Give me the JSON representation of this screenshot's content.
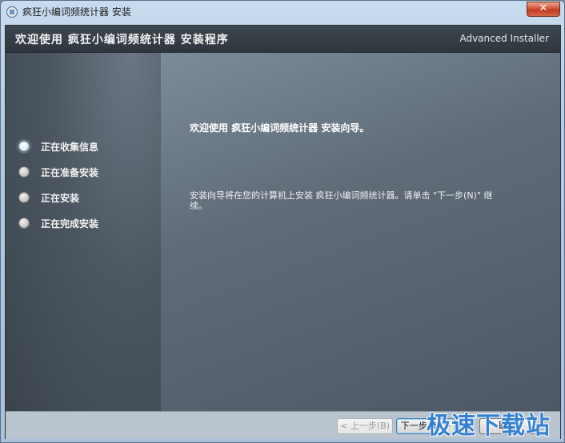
{
  "window": {
    "title": "疯狂小编词频统计器 安装",
    "close_glyph": "✕"
  },
  "header": {
    "title": "欢迎使用 疯狂小编词频统计器 安装程序",
    "brand": "Advanced Installer"
  },
  "steps": [
    {
      "label": "正在收集信息",
      "active": true
    },
    {
      "label": "正在准备安装",
      "active": false
    },
    {
      "label": "正在安装",
      "active": false
    },
    {
      "label": "正在完成安装",
      "active": false
    }
  ],
  "main": {
    "heading": "欢迎使用 疯狂小编词频统计器 安装向导。",
    "body": "安装向导将在您的计算机上安装 疯狂小编词频统计器。请单击 \"下一步(N)\" 继续。"
  },
  "footer": {
    "back_label": "< 上一步(B)",
    "next_label": "下一步(N) >",
    "cancel_label": "取消"
  },
  "watermark": "极速下载站",
  "colors": {
    "header_bg": "#2f363d",
    "panel_bg": "#5f6c78",
    "footer_bg": "#b9c4ce",
    "watermark": "#2a7bd4"
  }
}
